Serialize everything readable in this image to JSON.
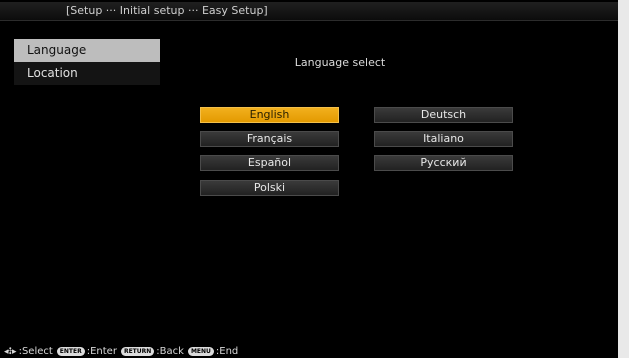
{
  "title": "[Setup ··· Initial setup ··· Easy Setup]",
  "sidebar": {
    "items": [
      {
        "label": "Language",
        "selected": true
      },
      {
        "label": "Location",
        "selected": false
      }
    ]
  },
  "main": {
    "heading": "Language select",
    "languages": [
      {
        "label": "English",
        "selected": true
      },
      {
        "label": "Deutsch",
        "selected": false
      },
      {
        "label": "Français",
        "selected": false
      },
      {
        "label": "Italiano",
        "selected": false
      },
      {
        "label": "Español",
        "selected": false
      },
      {
        "label": "Русский",
        "selected": false
      },
      {
        "label": "Polski",
        "selected": false
      }
    ]
  },
  "footer": {
    "select_label": ":Select",
    "enter_key": "ENTER",
    "enter_label": ":Enter",
    "return_key": "RETURN",
    "back_label": ":Back",
    "menu_key": "MENU",
    "end_label": ":End"
  },
  "colors": {
    "highlight": "#f2b01e",
    "sidebar_selected": "#bdbdbd"
  }
}
